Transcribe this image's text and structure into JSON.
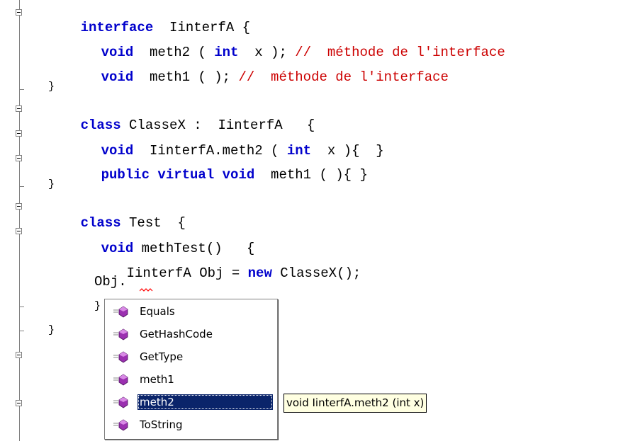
{
  "code": {
    "l1": {
      "kw": "interface",
      "rest": "  IinterfA {"
    },
    "l2": {
      "kw": "void",
      "mid": "  meth2 ( ",
      "kw2": "int",
      "rest": "  x ); ",
      "comment": "//  méthode de l'interface"
    },
    "l3": {
      "kw": "void",
      "rest": "  meth1 ( ); ",
      "comment": "//  méthode de l'interface"
    },
    "l4": "}",
    "l5": {
      "kw": "class",
      "rest": " ClasseX :  IinterfA   {"
    },
    "l6": {
      "kw": "void",
      "mid": "  IinterfA.meth2 ( ",
      "kw2": "int",
      "rest": "  x ){  }"
    },
    "l7": {
      "kw": "public virtual void",
      "rest": "  meth1 ( ){ }"
    },
    "l8": "}",
    "l9": {
      "kw": "class",
      "rest": " Test  {"
    },
    "l10": {
      "kw": "void",
      "rest": " methTest()   {"
    },
    "l11": {
      "pre": "IinterfA Obj = ",
      "kw": "new",
      "rest": " ClasseX();"
    },
    "l12": "Obj.",
    "l13": "}",
    "l14": "}"
  },
  "completion": {
    "items": [
      "Equals",
      "GetHashCode",
      "GetType",
      "meth1",
      "meth2",
      "ToString"
    ],
    "selected": "meth2",
    "icon": "method-icon"
  },
  "tooltip": "void IinterfA.meth2 (int x)",
  "colors": {
    "keyword": "#0000cc",
    "comment": "#cc0000",
    "selection": "#0a246a",
    "tooltip_bg": "#ffffe1",
    "method_icon": "#9b30b0"
  }
}
